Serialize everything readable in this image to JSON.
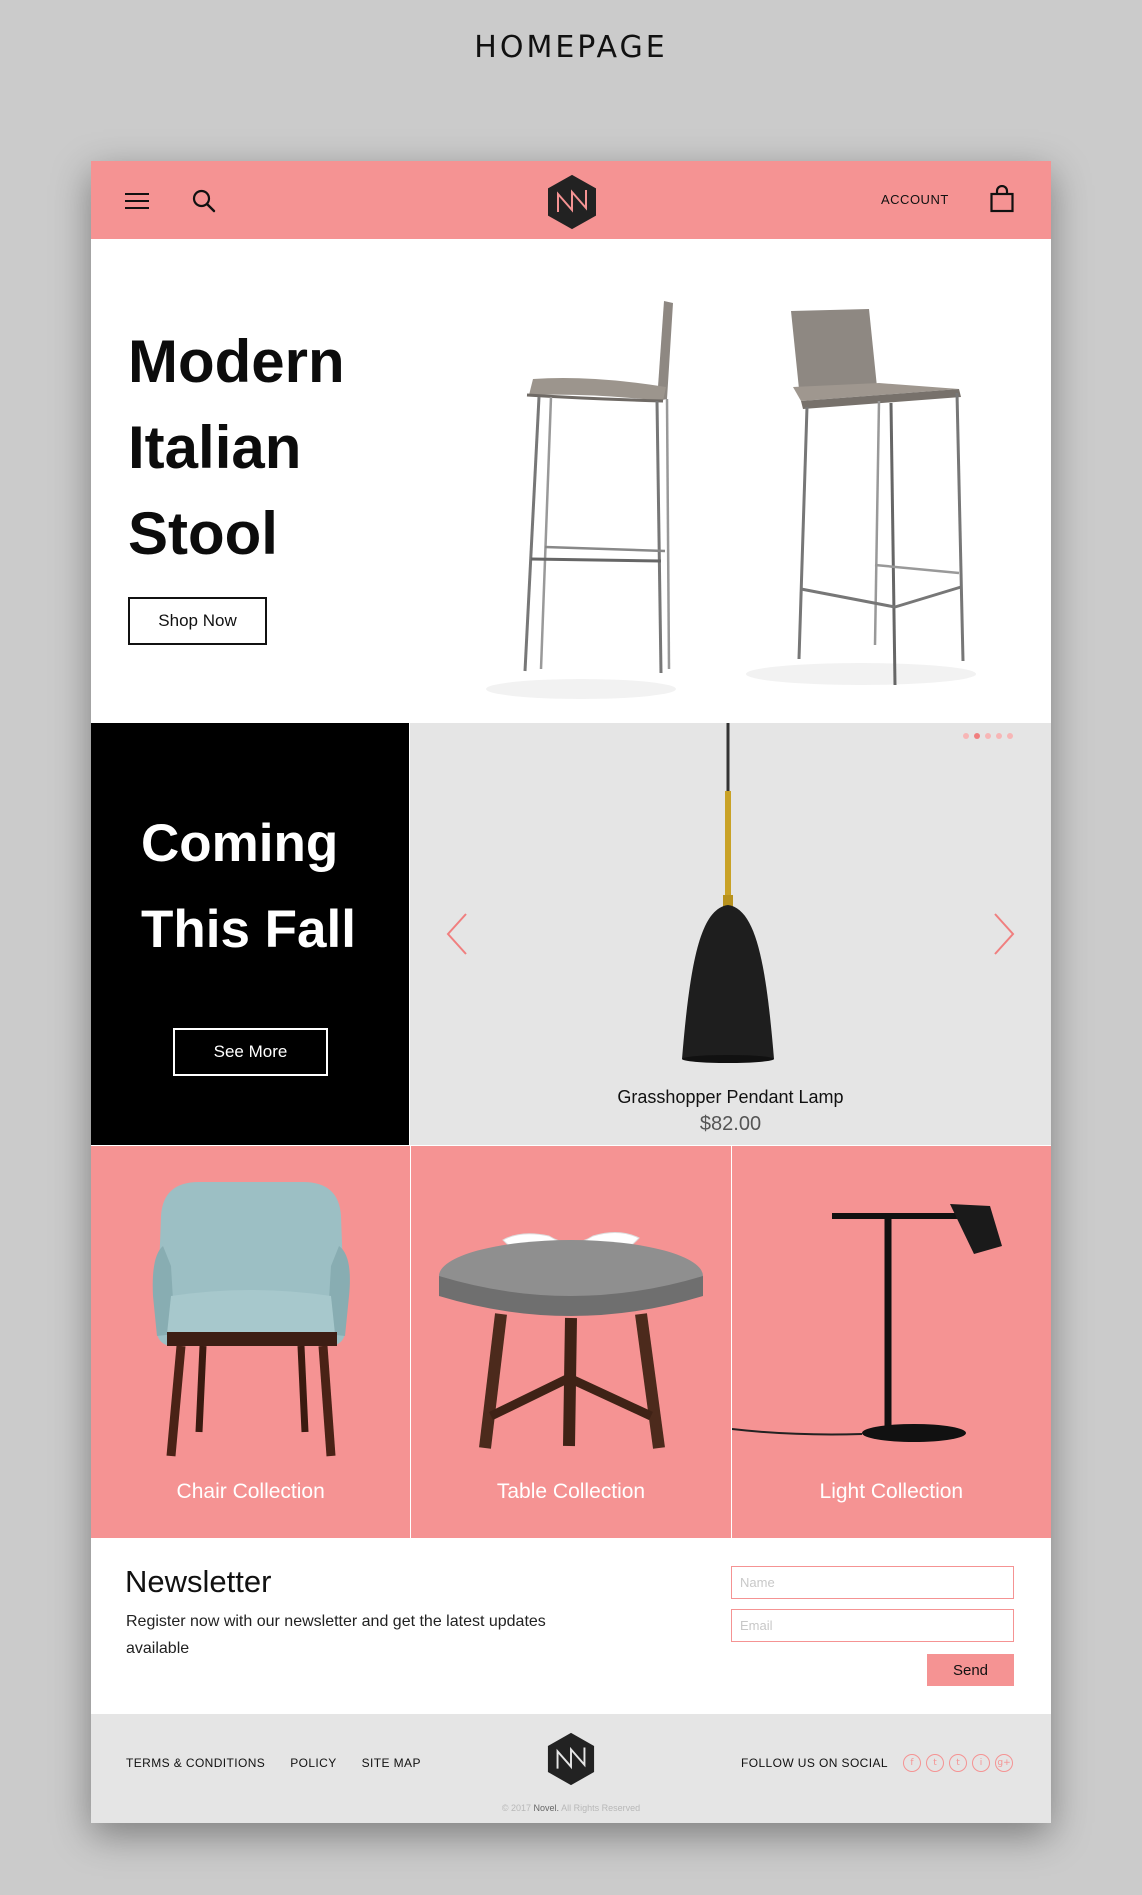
{
  "page_label": "HOMEPAGE",
  "colors": {
    "accent": "#f59393",
    "dark": "#000000",
    "light_gray": "#e5e5e5"
  },
  "header": {
    "menu_icon": "hamburger-menu-icon",
    "search_icon": "search-icon",
    "logo": "novel-logo",
    "account_label": "ACCOUNT",
    "bag_icon": "shopping-bag-icon"
  },
  "hero": {
    "title_lines": [
      "Modern",
      "Italian",
      "Stool"
    ],
    "button_label": "Shop Now"
  },
  "promo": {
    "title_lines": [
      "Coming",
      "This Fall"
    ],
    "button_label": "See More"
  },
  "carousel": {
    "dots": 5,
    "active_dot": 1,
    "product_name": "Grasshopper Pendant Lamp",
    "product_price": "$82.00"
  },
  "collections": [
    {
      "label": "Chair Collection"
    },
    {
      "label": "Table Collection"
    },
    {
      "label": "Light Collection"
    }
  ],
  "newsletter": {
    "title": "Newsletter",
    "text": "Register now with our newsletter and get the latest updates available",
    "name_placeholder": "Name",
    "email_placeholder": "Email",
    "send_label": "Send"
  },
  "footer": {
    "links": [
      "TERMS & CONDITIONS",
      "POLICY",
      "SITE MAP"
    ],
    "follow_label": "FOLLOW US ON SOCIAL",
    "socials": [
      "f",
      "t",
      "t",
      "i",
      "g+"
    ],
    "copyright_prefix": "© 2017 ",
    "copyright_brand": "Novel.",
    "copyright_suffix": " All Rights Reserved"
  }
}
